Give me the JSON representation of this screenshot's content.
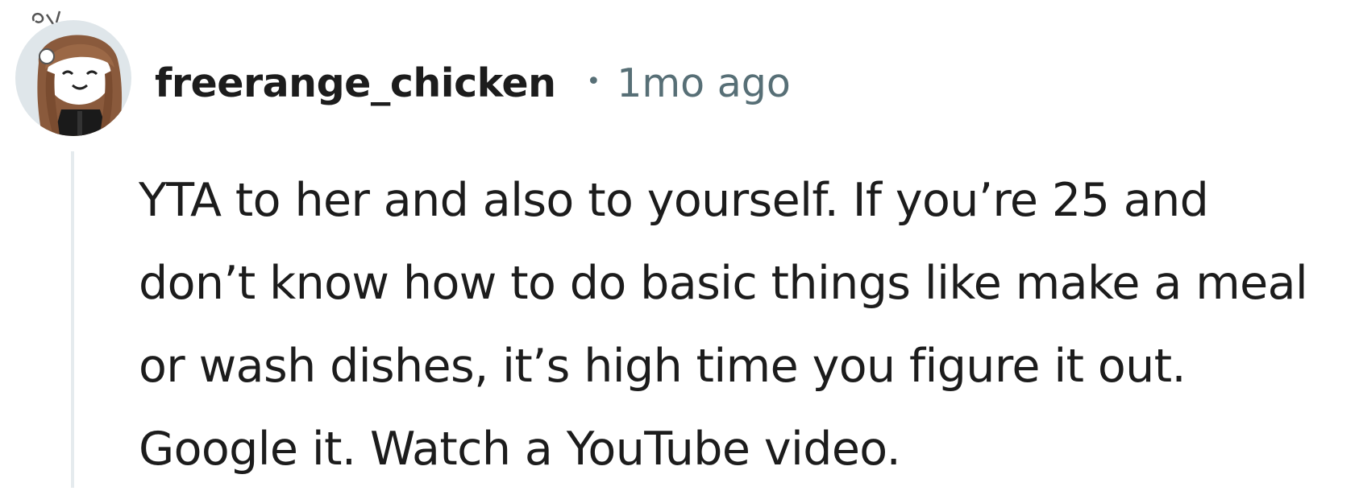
{
  "comment": {
    "author": "freerange_chicken",
    "separator": "•",
    "timestamp": "1mo ago",
    "body": "YTA to her and also to yourself. If you’re 25 and don’t know how to do basic things like make a meal or wash dishes, it’s high time you figure it out. Google it. Watch a YouTube video.",
    "avatar_icon": "cartoon-girl-avatar-icon"
  },
  "colors": {
    "text_primary": "#1c1c1c",
    "text_meta": "#576f76",
    "thread_line": "#e5ebee",
    "avatar_bg": "#dfe6ea"
  }
}
